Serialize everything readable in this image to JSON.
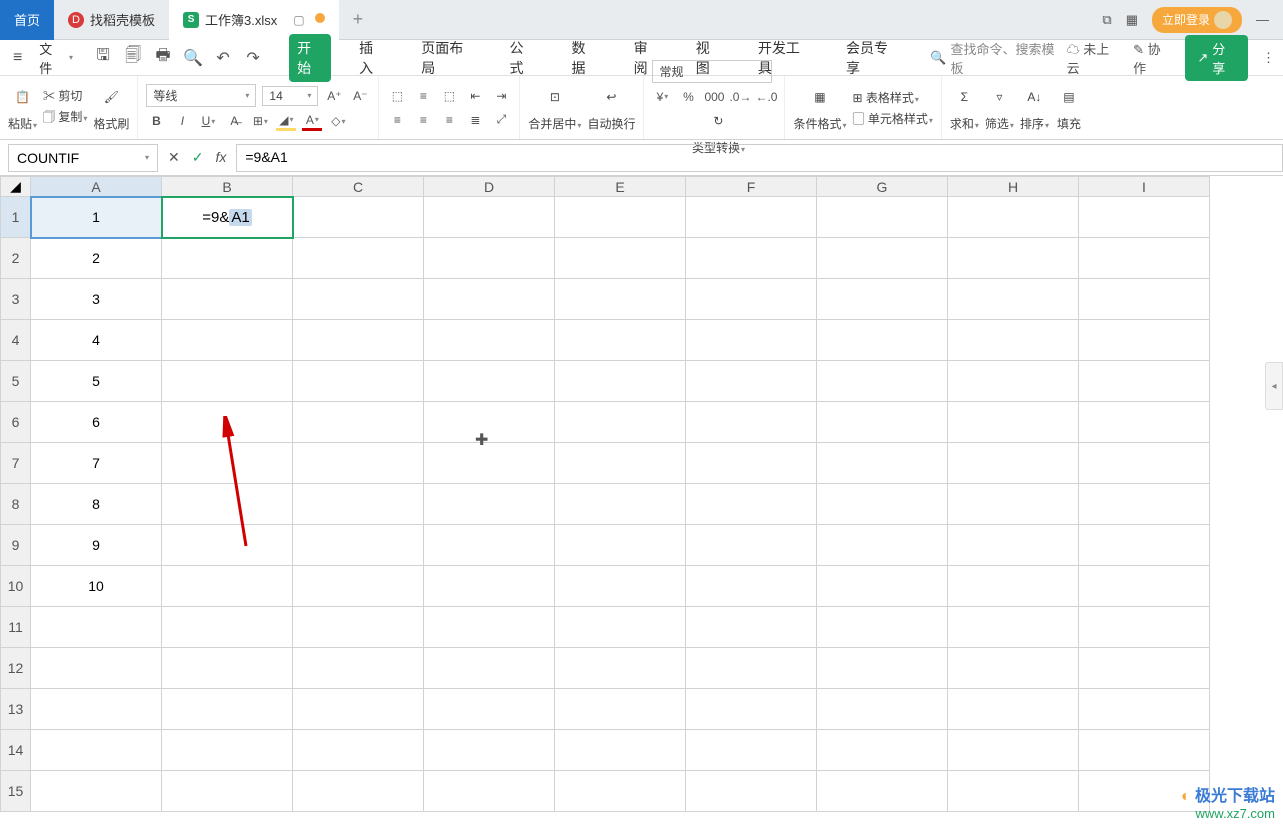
{
  "tabs": {
    "home": "首页",
    "template": "找稻壳模板",
    "workbook": "工作簿3.xlsx"
  },
  "titleRight": {
    "login": "立即登录"
  },
  "file": "文件",
  "menu": {
    "start": "开始",
    "insert": "插入",
    "pageLayout": "页面布局",
    "formula": "公式",
    "data": "数据",
    "review": "审阅",
    "view": "视图",
    "devTools": "开发工具",
    "member": "会员专享"
  },
  "search": "查找命令、搜索模板",
  "menuRight": {
    "notCloud": "未上云",
    "coop": "协作",
    "share": "分享"
  },
  "ribbon": {
    "paste": "粘贴",
    "cut": "剪切",
    "copy": "复制",
    "formatBrush": "格式刷",
    "fontName": "等线",
    "fontSize": "14",
    "mergeCenter": "合并居中",
    "autoWrap": "自动换行",
    "numberFormat": "常规",
    "typeConvert": "类型转换",
    "condFormat": "条件格式",
    "tableStyle": "表格样式",
    "cellStyle": "单元格样式",
    "sum": "求和",
    "filter": "筛选",
    "sort": "排序",
    "fill": "填充"
  },
  "nameBox": "COUNTIF",
  "formula": {
    "prefix": "=9&",
    "refPart": "A1",
    "full": "=9&A1"
  },
  "columns": [
    "A",
    "B",
    "C",
    "D",
    "E",
    "F",
    "G",
    "H",
    "I"
  ],
  "rows": [
    {
      "num": "1",
      "a": "1",
      "b_prefix": "=9&",
      "b_ref": "A1"
    },
    {
      "num": "2",
      "a": "2"
    },
    {
      "num": "3",
      "a": "3"
    },
    {
      "num": "4",
      "a": "4"
    },
    {
      "num": "5",
      "a": "5"
    },
    {
      "num": "6",
      "a": "6"
    },
    {
      "num": "7",
      "a": "7"
    },
    {
      "num": "8",
      "a": "8"
    },
    {
      "num": "9",
      "a": "9"
    },
    {
      "num": "10",
      "a": "10"
    },
    {
      "num": "11",
      "a": ""
    },
    {
      "num": "12",
      "a": ""
    },
    {
      "num": "13",
      "a": ""
    },
    {
      "num": "14",
      "a": ""
    },
    {
      "num": "15",
      "a": ""
    }
  ],
  "watermark": {
    "name": "极光下载站",
    "url": "www.xz7.com"
  }
}
